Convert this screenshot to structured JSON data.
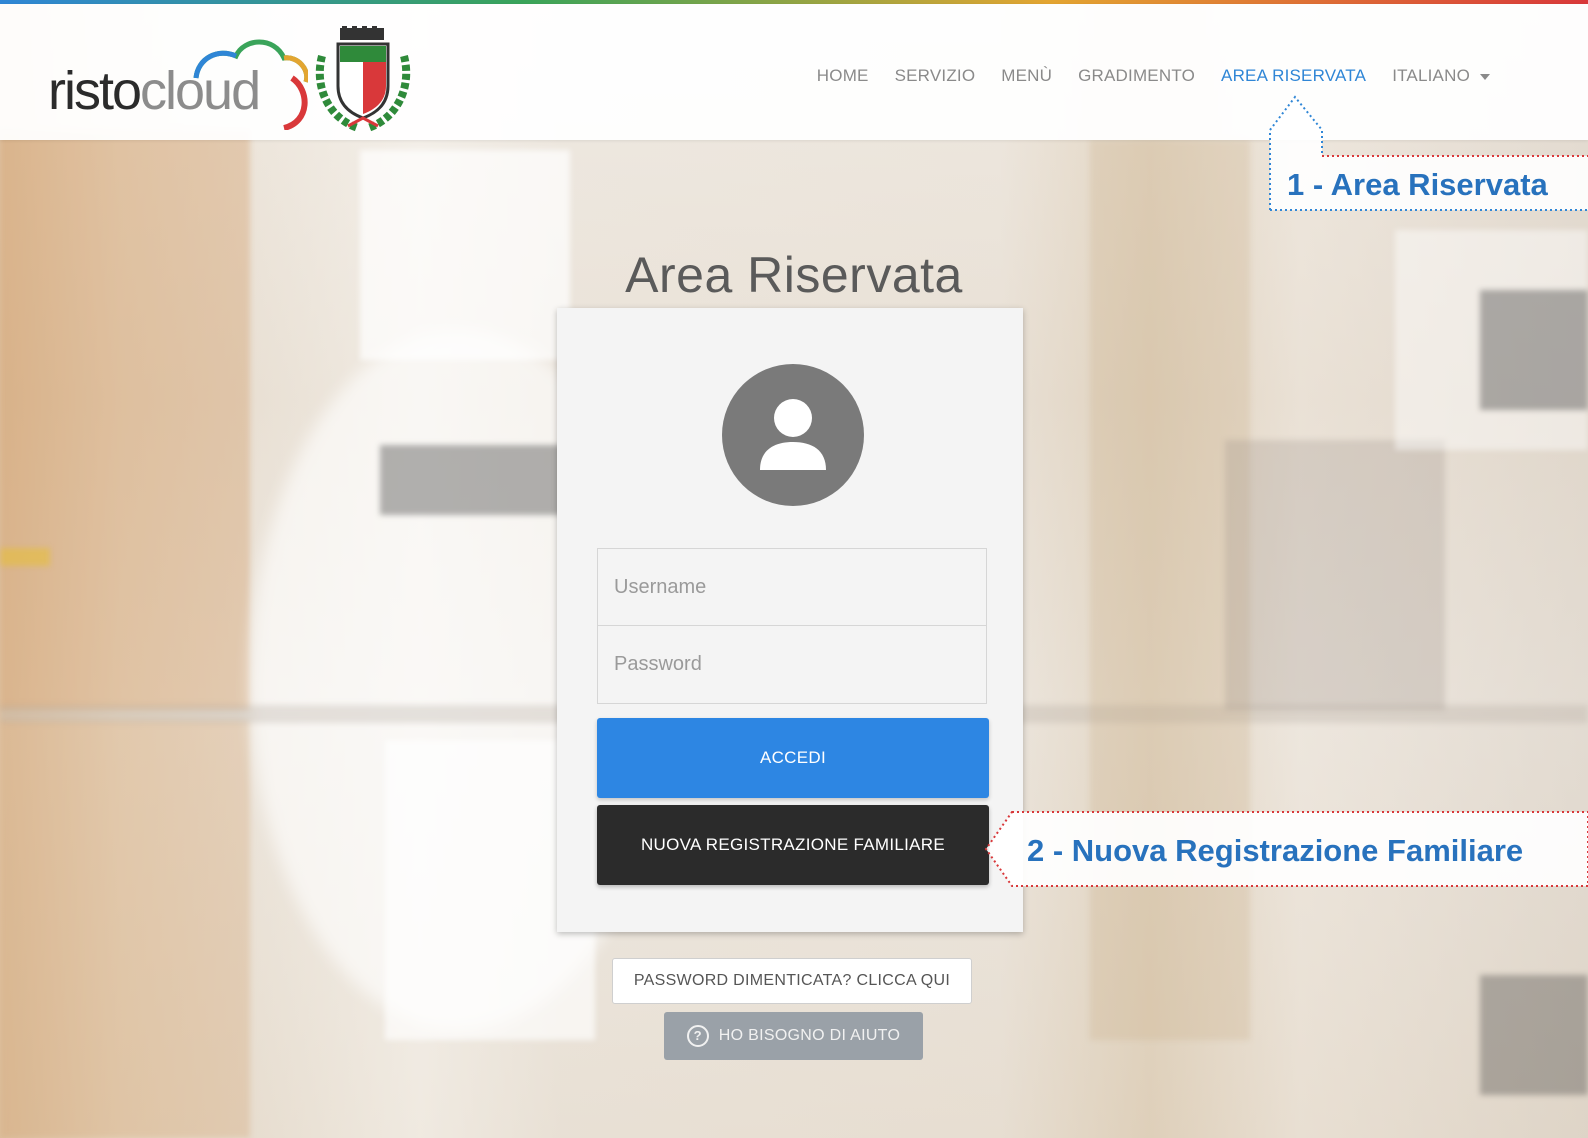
{
  "brand": {
    "logo_part1": "risto",
    "logo_part2": "cloud"
  },
  "nav": {
    "items": [
      {
        "label": "HOME"
      },
      {
        "label": "SERVIZIO"
      },
      {
        "label": "MENÙ"
      },
      {
        "label": "GRADIMENTO"
      },
      {
        "label": "AREA RISERVATA"
      },
      {
        "label": "ITALIANO"
      }
    ],
    "active_index": 4
  },
  "page": {
    "title": "Area Riservata"
  },
  "login": {
    "avatar_icon": "user-icon",
    "username_placeholder": "Username",
    "password_placeholder": "Password",
    "accedi_label": "ACCEDI",
    "register_label": "NUOVA REGISTRAZIONE FAMILIARE",
    "forgot_label": "PASSWORD DIMENTICATA? CLICCA QUI",
    "help_label": "HO BISOGNO DI AIUTO",
    "help_icon": "question-circle-icon"
  },
  "annotations": {
    "callout1": "1 - Area Riservata",
    "callout2": "2 - Nuova Registrazione Familiare"
  },
  "colors": {
    "accent": "#2f86d6",
    "primary_button": "#2d86e3",
    "dark_button": "#2b2b2b",
    "help_button": "#9aa1a8",
    "callout_text": "#2872bd",
    "callout_border": "#d9383a"
  }
}
